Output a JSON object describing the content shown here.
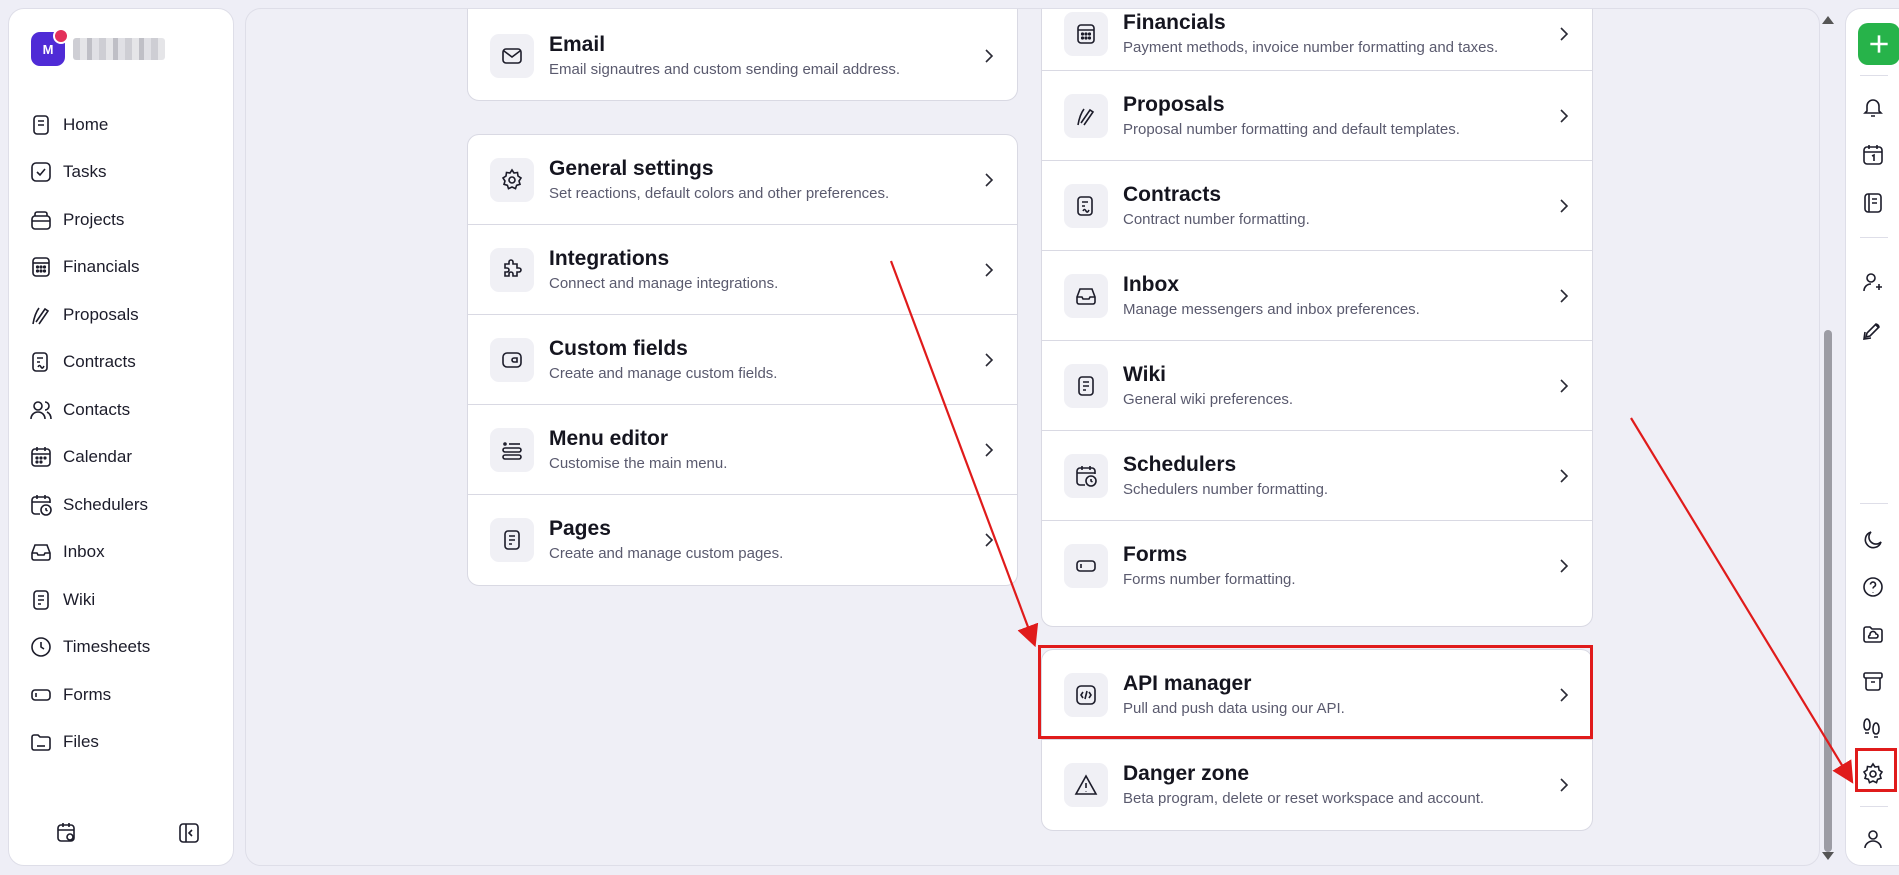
{
  "workspace": {
    "initial": "M"
  },
  "sidebar": {
    "items": [
      {
        "label": "Home",
        "icon": "home-icon"
      },
      {
        "label": "Tasks",
        "icon": "tasks-icon"
      },
      {
        "label": "Projects",
        "icon": "projects-icon"
      },
      {
        "label": "Financials",
        "icon": "financials-icon"
      },
      {
        "label": "Proposals",
        "icon": "proposals-icon"
      },
      {
        "label": "Contracts",
        "icon": "contracts-icon"
      },
      {
        "label": "Contacts",
        "icon": "contacts-icon"
      },
      {
        "label": "Calendar",
        "icon": "calendar-icon"
      },
      {
        "label": "Schedulers",
        "icon": "schedulers-icon"
      },
      {
        "label": "Inbox",
        "icon": "inbox-icon"
      },
      {
        "label": "Wiki",
        "icon": "wiki-icon"
      },
      {
        "label": "Timesheets",
        "icon": "timesheets-icon"
      },
      {
        "label": "Forms",
        "icon": "forms-icon"
      },
      {
        "label": "Files",
        "icon": "files-icon"
      }
    ]
  },
  "left_column": {
    "email": {
      "title": "Email",
      "subtitle": "Email signautres and custom sending email address."
    },
    "general": [
      {
        "title": "General settings",
        "subtitle": "Set reactions, default colors and other preferences."
      },
      {
        "title": "Integrations",
        "subtitle": "Connect and manage integrations."
      },
      {
        "title": "Custom fields",
        "subtitle": "Create and manage custom fields."
      },
      {
        "title": "Menu editor",
        "subtitle": "Customise the main menu."
      },
      {
        "title": "Pages",
        "subtitle": "Create and manage custom pages."
      }
    ]
  },
  "right_column": {
    "modules": [
      {
        "title": "Financials",
        "subtitle": "Payment methods, invoice number formatting and taxes."
      },
      {
        "title": "Proposals",
        "subtitle": "Proposal number formatting and default templates."
      },
      {
        "title": "Contracts",
        "subtitle": "Contract number formatting."
      },
      {
        "title": "Inbox",
        "subtitle": "Manage messengers and inbox preferences."
      },
      {
        "title": "Wiki",
        "subtitle": "General wiki preferences."
      },
      {
        "title": "Schedulers",
        "subtitle": "Schedulers number formatting."
      },
      {
        "title": "Forms",
        "subtitle": "Forms number formatting."
      }
    ],
    "account": [
      {
        "title": "API manager",
        "subtitle": "Pull and push data using our API."
      },
      {
        "title": "Danger zone",
        "subtitle": "Beta program, delete or reset workspace and account."
      }
    ]
  },
  "colors": {
    "accent": "#4f2bd6",
    "add": "#27b34a",
    "annotation": "#e01b1b"
  }
}
